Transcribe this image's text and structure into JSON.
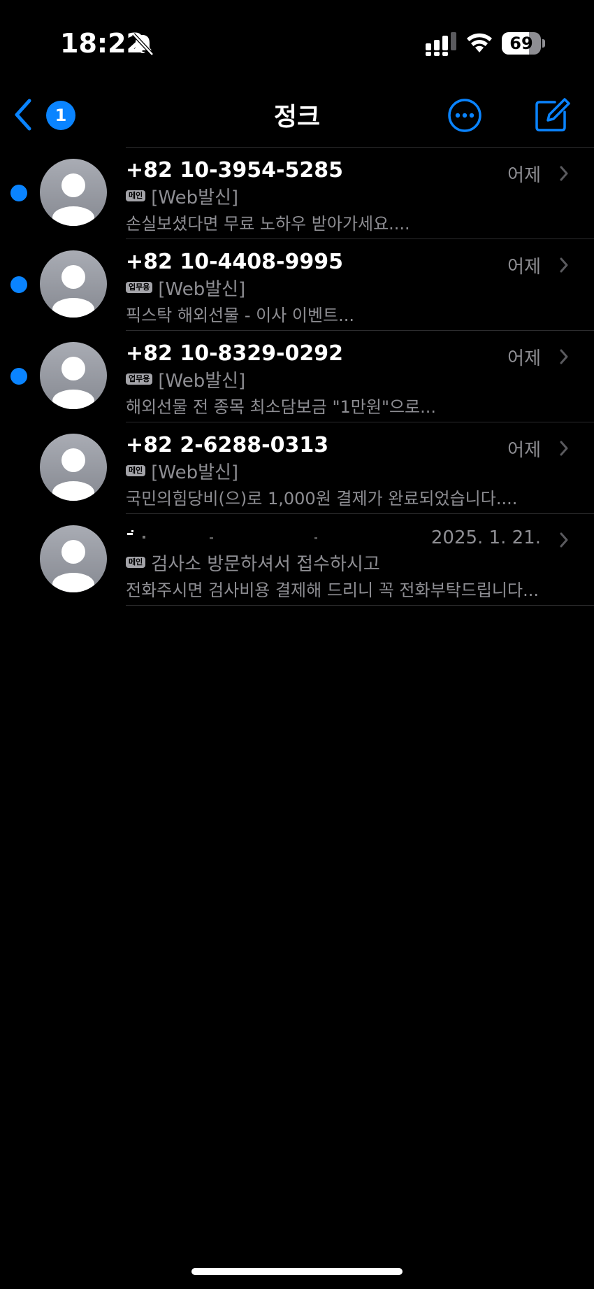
{
  "status_bar": {
    "time": "18:22",
    "silent_icon": "bell-slash-icon",
    "signal_icon": "cellular-signal-icon",
    "wifi_icon": "wifi-icon",
    "battery_percent": 69,
    "battery_label": "69"
  },
  "nav": {
    "back_icon": "chevron-left-icon",
    "back_badge": "1",
    "title": "정크",
    "more_icon": "ellipsis-circle-icon",
    "compose_icon": "compose-icon"
  },
  "colors": {
    "accent": "#0a84ff",
    "background": "#000000",
    "secondary_text": "#8e8e93",
    "divider": "#2c2c2e"
  },
  "messages": [
    {
      "sender": "+82 10-3954-5285",
      "date": "어제",
      "unread": true,
      "tag": "메인",
      "line2": "[Web발신]",
      "preview": "손실보셨다면 무료 노하우 받아가세요...."
    },
    {
      "sender": "+82 10-4408-9995",
      "date": "어제",
      "unread": true,
      "tag": "업무용",
      "line2": "[Web발신]",
      "preview": "픽스탁 해외선물 - 이사 이벤트..."
    },
    {
      "sender": "+82 10-8329-0292",
      "date": "어제",
      "unread": true,
      "tag": "업무용",
      "line2": "[Web발신]",
      "preview": "해외선물 전 종목 최소담보금 \"1만원\"으로..."
    },
    {
      "sender": "+82 2-6288-0313",
      "date": "어제",
      "unread": false,
      "tag": "메인",
      "line2": "[Web발신]",
      "preview": "국민의힘당비(으)로 1,000원 결제가 완료되었습니다...."
    },
    {
      "sender": "",
      "date": "2025. 1. 21.",
      "unread": false,
      "tag": "메인",
      "line2": "검사소 방문하셔서 접수하시고",
      "preview": "전화주시면 검사비용 결제해 드리니 꼭 전화부탁드립니다..."
    }
  ]
}
